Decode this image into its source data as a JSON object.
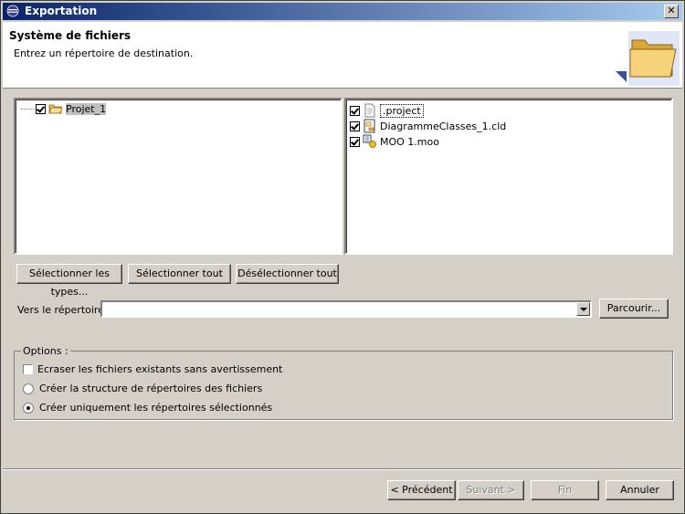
{
  "window": {
    "title": "Exportation",
    "close_label": "✕"
  },
  "header": {
    "heading": "Système de fichiers",
    "description": "Entrez un répertoire de destination."
  },
  "tree": {
    "items": [
      {
        "label": "Projet_1",
        "checked": true,
        "icon": "open-folder-icon"
      }
    ]
  },
  "files": {
    "items": [
      {
        "label": ".project",
        "checked": true,
        "icon": "document-icon"
      },
      {
        "label": "DiagrammeClasses_1.cld",
        "checked": true,
        "icon": "class-diagram-icon"
      },
      {
        "label": "MOO 1.moo",
        "checked": true,
        "icon": "model-icon"
      }
    ]
  },
  "buttons": {
    "select_types": "Sélectionner les types...",
    "select_all": "Sélectionner tout",
    "deselect_all": "Désélectionner tout",
    "browse": "Parcourir...",
    "previous": "< Précédent",
    "next": "Suivant >",
    "finish": "Fin",
    "cancel": "Annuler"
  },
  "directory": {
    "label": "Vers le répertoire :",
    "value": ""
  },
  "options": {
    "title": "Options :",
    "overwrite": {
      "label": "Ecraser les fichiers existants sans avertissement",
      "checked": false
    },
    "create_structure": {
      "label": "Créer la structure de répertoires des fichiers",
      "selected": false
    },
    "create_selected": {
      "label": "Créer uniquement les répertoires sélectionnés",
      "selected": true
    }
  },
  "colors": {
    "titlebar_start": "#0a246a",
    "titlebar_end": "#a6caf0",
    "dialog_bg": "#d4d0c8"
  }
}
